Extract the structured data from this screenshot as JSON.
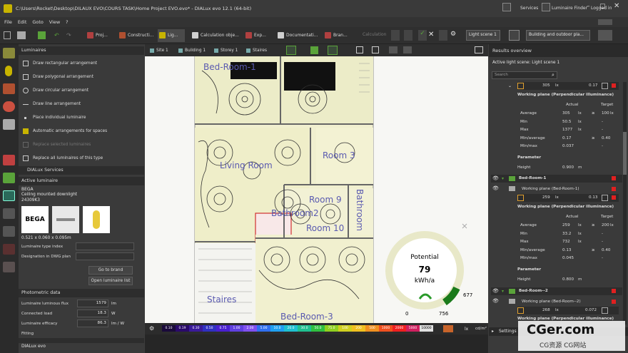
{
  "titlebar": {
    "title": "C:\\Users\\Rocket\\Desktop\\DILAUX EVO\\COURS TASK\\Home Project EVO.evo* - DIALux evo 12.1   (64-bit)"
  },
  "menu": [
    "File",
    "Edit",
    "Goto",
    "View",
    "?"
  ],
  "topright": {
    "services": "Services",
    "luminaire_finder": "Luminaire Finder",
    "logged_in": "Logged in"
  },
  "modes": [
    "Proj...",
    "Constructi...",
    "Lig...",
    "Calculation obje...",
    "Exp...",
    "Documentati...",
    "Bran..."
  ],
  "calc_label": "Calculation",
  "light_scene": "Light scene 1",
  "building_select": "Building and outdoor pla...",
  "left_icons": [
    "luminaire-icon",
    "bulb-icon",
    "wire-icon",
    "color-icon",
    "exit-sign-icon",
    "wrench-icon",
    "plant-icon",
    "plan-view-icon"
  ],
  "lum_section": "Luminaires",
  "lum_items": [
    "Draw rectangular arrangement",
    "Draw polygonal arrangement",
    "Draw circular arrangement",
    "Draw line arrangement",
    "Place individual luminaire",
    "Automatic arrangements for spaces",
    "Replace selected luminaires",
    "Replace all luminaires of this type"
  ],
  "dialux_services": "DIALux Services",
  "active_lum": {
    "section": "Active luminaire",
    "brand": "BEGA",
    "desc": "Ceiling mounted downlight",
    "code": "24309K3",
    "brand_logo": "BEGA",
    "dims": "0.521 x 0.060 x 0.095m",
    "type_index_label": "Luminaire type index",
    "designation_label": "Designation in DWG plan",
    "goto_brand": "Go to brand",
    "open_list": "Open luminaire list"
  },
  "photometric": {
    "section": "Photometric data",
    "rows": [
      {
        "label": "Luminaire luminous flux",
        "value": "1579",
        "unit": "lm"
      },
      {
        "label": "Connected load",
        "value": "18.3",
        "unit": "W"
      },
      {
        "label": "Luminaire efficacy",
        "value": "86.3",
        "unit": "lm / W"
      },
      {
        "label": "Fitting",
        "value": "",
        "unit": ""
      }
    ]
  },
  "canvas_tabs": [
    "Site 1",
    "Building 1",
    "Storey 1",
    "Staires"
  ],
  "rooms": [
    {
      "label": "Bed-Room-1"
    },
    {
      "label": "Living Room"
    },
    {
      "label": "Room 3"
    },
    {
      "label": "Room 9"
    },
    {
      "label": "Bathroom2"
    },
    {
      "label": "Room 10"
    },
    {
      "label": "Bathroom"
    },
    {
      "label": "Staires"
    },
    {
      "label": "Bed-Room-3"
    }
  ],
  "potential": {
    "title": "Potential",
    "value": "79",
    "unit": "kWh/a",
    "min": "0",
    "current": "756",
    "max": "677"
  },
  "scale": {
    "values": [
      "0.10",
      "0.19",
      "0.30",
      "0.50",
      "0.75",
      "1.00",
      "2.00",
      "5.00",
      "10.0",
      "20.0",
      "30.0",
      "50.0",
      "75.0",
      "100",
      "200",
      "500",
      "1000",
      "2000",
      "5000",
      "10000"
    ],
    "colors": [
      "#1a0a3a",
      "#2a0a6a",
      "#3a1a9a",
      "#3030c0",
      "#4a20d0",
      "#6040e0",
      "#8050f0",
      "#3070f0",
      "#20a0f0",
      "#20c0d0",
      "#20c090",
      "#30c040",
      "#90d020",
      "#d0d020",
      "#f0c020",
      "#f09020",
      "#f05020",
      "#f02020",
      "#d02060",
      "#e0e0e0"
    ],
    "unit": "lx",
    "unit2": "cd/m²"
  },
  "results": {
    "header": "Results overview",
    "scene": "Active light scene: Light scene 1",
    "search_placeholder": "Search",
    "block1": {
      "value": "305",
      "unit": "lx",
      "uo": "0.17",
      "wp_title": "Working plane (Perpendicular illuminance)",
      "col_actual": "Actual",
      "col_target": "Target",
      "rows": [
        {
          "label": "Average",
          "actual": "305",
          "unit": "lx",
          "op": "≥",
          "target": "100",
          "tunit": "lx"
        },
        {
          "label": "Min",
          "actual": "50.5",
          "unit": "lx",
          "op": "",
          "target": "-",
          "tunit": ""
        },
        {
          "label": "Max",
          "actual": "1377",
          "unit": "lx",
          "op": "",
          "target": "-",
          "tunit": ""
        },
        {
          "label": "Min/average",
          "actual": "0.17",
          "unit": "",
          "op": "≥",
          "target": "0.40",
          "tunit": ""
        },
        {
          "label": "Min/max",
          "actual": "0.037",
          "unit": "",
          "op": "",
          "target": "-",
          "tunit": ""
        }
      ],
      "param": "Parameter",
      "height_label": "Height",
      "height_value": "0.900",
      "height_unit": "m"
    },
    "room1": "Bed-Room-1",
    "wp1": "Working plane (Bed-Room-1)",
    "block2": {
      "value": "259",
      "unit": "lx",
      "uo": "0.13",
      "wp_title": "Working plane (Perpendicular illuminance)",
      "col_actual": "Actual",
      "col_target": "Target",
      "rows": [
        {
          "label": "Average",
          "actual": "259",
          "unit": "lx",
          "op": "≥",
          "target": "200",
          "tunit": "lx"
        },
        {
          "label": "Min",
          "actual": "33.2",
          "unit": "lx",
          "op": "",
          "target": "-",
          "tunit": ""
        },
        {
          "label": "Max",
          "actual": "732",
          "unit": "lx",
          "op": "",
          "target": "-",
          "tunit": ""
        },
        {
          "label": "Min/average",
          "actual": "0.13",
          "unit": "",
          "op": "≥",
          "target": "0.40",
          "tunit": ""
        },
        {
          "label": "Min/max",
          "actual": "0.045",
          "unit": "",
          "op": "",
          "target": "-",
          "tunit": ""
        }
      ],
      "param": "Parameter",
      "height_label": "Height",
      "height_value": "0.800",
      "height_unit": "m"
    },
    "room2": "Bed-Room--2",
    "wp2": "Working plane (Bed-Room--2)",
    "block3": {
      "value": "268",
      "unit": "lx",
      "uo": "0.072",
      "wp_title": "Working plane (Perpendicular illuminance)"
    },
    "settings": "Settings"
  },
  "statusbar": {
    "app": "DIALux evo"
  },
  "watermark": {
    "site": "CGer.com",
    "sub": "CG资源  CG网站"
  }
}
